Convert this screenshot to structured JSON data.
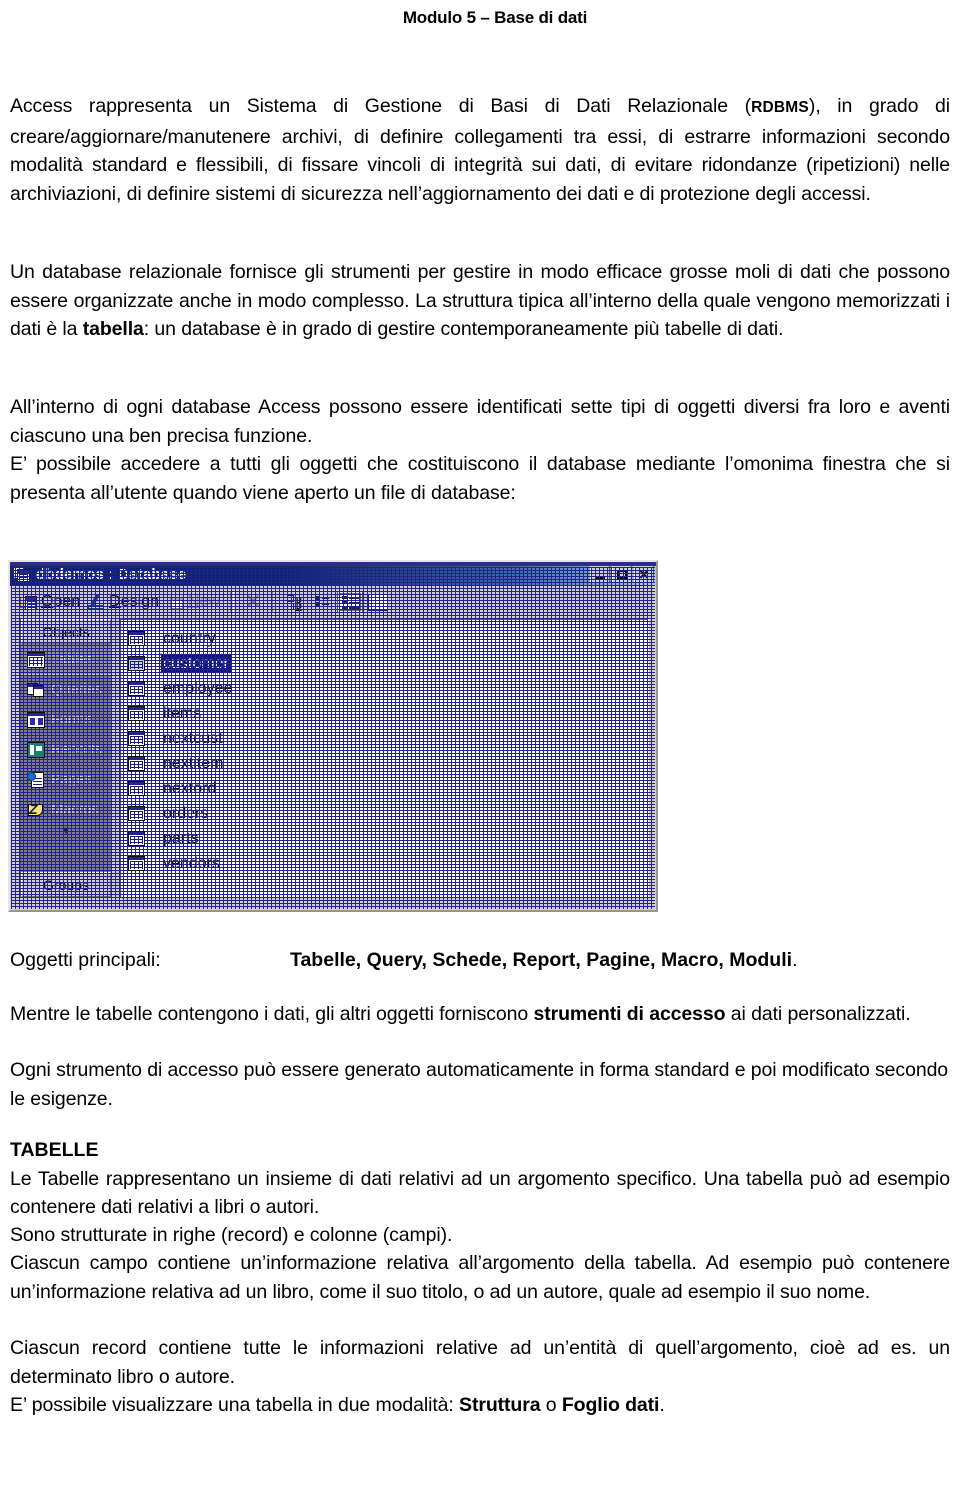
{
  "header": {
    "title": "Modulo 5 – Base di dati"
  },
  "paragraphs": {
    "p1_before": "Access rappresenta un Sistema di Gestione di Basi di Dati Relazionale (",
    "p1_acronym": "RDBMS",
    "p1_after": "), in grado di creare/aggiornare/manutenere archivi, di definire collegamenti tra essi, di estrarre informazioni secondo modalità standard e flessibili, di fissare vincoli di integrità sui dati, di evitare ridondanze (ripetizioni) nelle archiviazioni, di definire sistemi di sicurezza nell’aggiornamento dei dati e di protezione degli accessi.",
    "p2_a": "Un database relazionale fornisce gli strumenti per gestire in modo efficace grosse moli di dati che possono essere organizzate anche in modo complesso. La struttura tipica all’interno della quale vengono memorizzati i dati è la ",
    "p2_bold": "tabella",
    "p2_b": ": un database è in grado di gestire contemporaneamente più tabelle di dati.",
    "p3": "All’interno di ogni database Access possono essere identificati sette tipi di oggetti diversi fra loro e aventi ciascuno una ben precisa funzione.",
    "p4": "E’ possibile accedere a tutti gli oggetti che costituiscono il database mediante l’omonima finestra che si presenta all’utente quando viene aperto un file di database:",
    "objects_label": "Oggetti principali:",
    "objects_bold": "Tabelle, Query, Schede, Report, Pagine, Macro, Moduli",
    "objects_period": ".",
    "p5_a": "Mentre le tabelle contengono i dati, gli altri oggetti forniscono ",
    "p5_bold": "strumenti di accesso",
    "p5_b": " ai dati personalizzati.",
    "p6": "Ogni strumento di accesso può essere generato automaticamente in forma standard e poi modificato secondo le esigenze.",
    "section_title": "TABELLE",
    "p7": "Le Tabelle rappresentano un insieme di dati relativi ad un argomento specifico. Una tabella può ad esempio contenere dati relativi a libri o autori.",
    "p8": "Sono strutturate in righe (record) e colonne (campi).",
    "p9": "Ciascun campo contiene un’informazione relativa all’argomento della tabella. Ad esempio può contenere un’informazione relativa ad un libro, come il suo titolo, o ad un autore, quale ad esempio il suo nome.",
    "p10": "Ciascun record contiene tutte le informazioni relative ad un’entità di quell’argomento, cioè ad es. un determinato libro o autore.",
    "p11_a": "E’ possibile visualizzare una tabella in due modalità: ",
    "p11_bold1": "Struttura",
    "p11_mid": " o ",
    "p11_bold2": "Foglio dati",
    "p11_b": "."
  },
  "access_window": {
    "title": "dbdemos : Database",
    "title_icon": "database-window-icon",
    "window_buttons": {
      "minimize": "_",
      "maximize": "□",
      "close": "×"
    },
    "toolbar": [
      {
        "id": "open",
        "label": "Open",
        "accel": "O",
        "icon": "open-folder-table-icon",
        "disabled": false
      },
      {
        "id": "design",
        "label": "Design",
        "accel": "D",
        "icon": "design-ruler-pencil-icon",
        "disabled": false
      },
      {
        "id": "new",
        "label": "New",
        "accel": "N",
        "icon": "new-table-sparkle-icon",
        "disabled": true
      },
      {
        "id": "delete",
        "label": "×",
        "icon": "delete-x-icon",
        "disabled": true
      },
      {
        "id": "large-icons",
        "label": "",
        "icon": "large-icons-view-icon",
        "disabled": false
      },
      {
        "id": "small-icons",
        "label": "",
        "icon": "small-icons-view-icon",
        "disabled": false
      },
      {
        "id": "list",
        "label": "",
        "icon": "list-view-icon",
        "disabled": false,
        "selected": true
      },
      {
        "id": "details",
        "label": "",
        "icon": "details-view-icon",
        "disabled": false
      }
    ],
    "objects_pane": {
      "header": "Objects",
      "footer": "Groups",
      "more_arrow": "▼",
      "items": [
        {
          "label": "Tables",
          "icon": "tables-icon",
          "selected": true
        },
        {
          "label": "Queries",
          "icon": "queries-icon",
          "selected": false
        },
        {
          "label": "Forms",
          "icon": "forms-icon",
          "selected": false
        },
        {
          "label": "Reports",
          "icon": "reports-icon",
          "selected": false
        },
        {
          "label": "Pages",
          "icon": "pages-icon",
          "selected": false
        },
        {
          "label": "Macros",
          "icon": "macros-icon",
          "selected": false
        }
      ]
    },
    "tables": [
      {
        "name": "country",
        "selected": false
      },
      {
        "name": "customer",
        "selected": true
      },
      {
        "name": "employee",
        "selected": false
      },
      {
        "name": "items",
        "selected": false
      },
      {
        "name": "nextcust",
        "selected": false
      },
      {
        "name": "nextitem",
        "selected": false
      },
      {
        "name": "nextord",
        "selected": false
      },
      {
        "name": "orders",
        "selected": false
      },
      {
        "name": "parts",
        "selected": false
      },
      {
        "name": "vendors",
        "selected": false
      }
    ]
  },
  "colors": {
    "title_bar_dark": "#0a246a",
    "title_bar_light": "#a6caf0",
    "window_face": "#d4d0c8",
    "objects_pane": "#808080",
    "selection": "#12127e"
  }
}
